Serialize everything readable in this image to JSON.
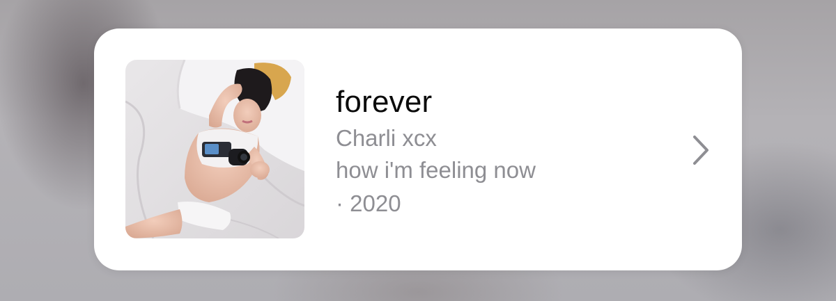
{
  "track": {
    "title": "forever",
    "artist": "Charli xcx",
    "album": "how i'm feeling now",
    "year_line": "· 2020"
  },
  "artwork": {
    "description_icon": "album-artwork-image"
  },
  "actions": {
    "open_icon": "chevron-right-icon"
  },
  "colors": {
    "card_background": "#ffffff",
    "title_text": "#0b0b0b",
    "secondary_text": "#8e8e93",
    "chevron": "#8e8e93"
  }
}
